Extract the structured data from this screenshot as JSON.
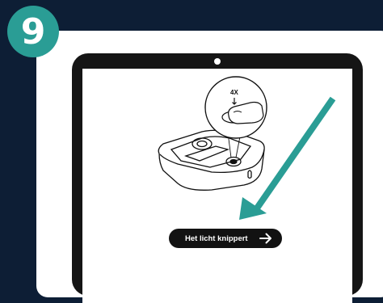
{
  "step": {
    "number": "9"
  },
  "illustration": {
    "tap_count": "4X"
  },
  "action": {
    "label": "Het licht knippert"
  },
  "colors": {
    "background": "#0d1e35",
    "accent": "#2a9d95",
    "tablet": "#151515",
    "pill": "#121212"
  },
  "icons": {
    "pill_arrow": "arrow-right-icon",
    "pointer": "diagonal-arrow-icon",
    "finger": "finger-press-icon"
  }
}
